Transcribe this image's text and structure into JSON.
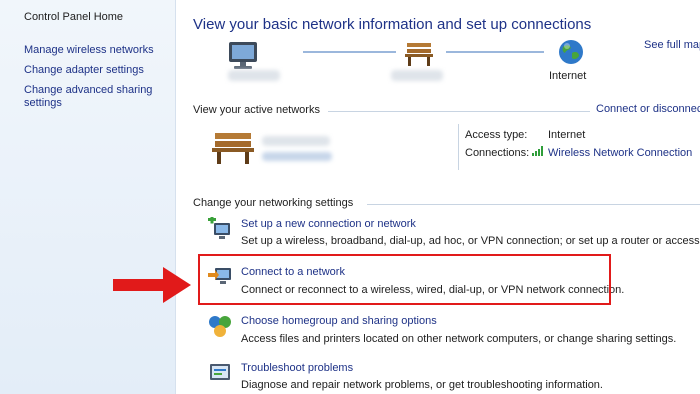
{
  "sidebar": {
    "home": "Control Panel Home",
    "links": [
      {
        "label": "Manage wireless networks"
      },
      {
        "label": "Change adapter settings"
      },
      {
        "label": "Change advanced sharing settings"
      }
    ]
  },
  "header": {
    "title": "View your basic network information and set up connections",
    "see_full_map": "See full map"
  },
  "network_map": {
    "internet_label": "Internet"
  },
  "active_networks": {
    "heading": "View your active networks",
    "connect_disconnect": "Connect or disconnect",
    "access_type_label": "Access type:",
    "access_type_value": "Internet",
    "connections_label": "Connections:",
    "connections_value": "Wireless Network Connection"
  },
  "settings": {
    "heading": "Change your networking settings",
    "tasks": [
      {
        "title": "Set up a new connection or network",
        "desc": "Set up a wireless, broadband, dial-up, ad hoc, or VPN connection; or set up a router or access point."
      },
      {
        "title": "Connect to a network",
        "desc": "Connect or reconnect to a wireless, wired, dial-up, or VPN network connection."
      },
      {
        "title": "Choose homegroup and sharing options",
        "desc": "Access files and printers located on other network computers, or change sharing settings."
      },
      {
        "title": "Troubleshoot problems",
        "desc": "Diagnose and repair network problems, or get troubleshooting information."
      }
    ]
  },
  "colors": {
    "link": "#1e3287",
    "highlight": "#e11a1a",
    "arrow": "#e11a1a"
  }
}
